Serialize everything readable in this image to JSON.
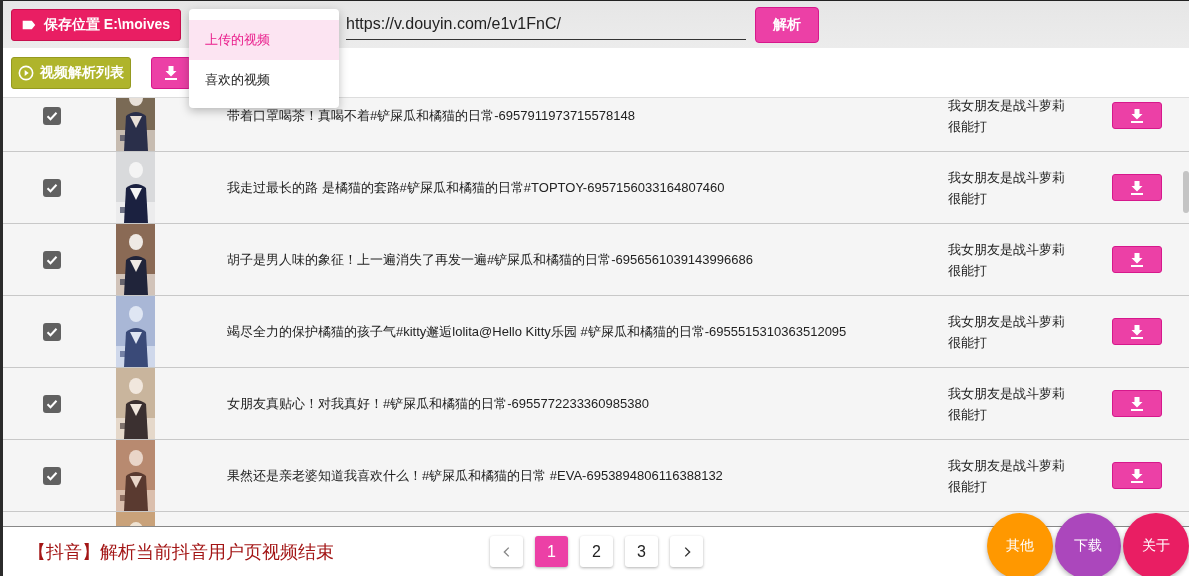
{
  "save_button": {
    "label": "保存位置 E:\\moives"
  },
  "menu": {
    "items": [
      {
        "label": "上传的视频",
        "selected": true
      },
      {
        "label": "喜欢的视频",
        "selected": false
      }
    ]
  },
  "url_field": {
    "value": "https://v.douyin.com/e1v1FnC/"
  },
  "parse_button": {
    "label": "解析"
  },
  "list_button": {
    "label": "视频解析列表"
  },
  "rows": [
    {
      "kind": "full",
      "checked": true,
      "title": "带着口罩喝茶！真喝不着#铲屎瓜和橘猫的日常-6957911973715578148",
      "author": "我女朋友是战斗萝莉很能打"
    },
    {
      "kind": "full",
      "checked": true,
      "title": "我走过最长的路 是橘猫的套路#铲屎瓜和橘猫的日常#TOPTOY-6957156033164807460",
      "author": "我女朋友是战斗萝莉很能打"
    },
    {
      "kind": "full",
      "checked": true,
      "title": "胡子是男人味的象征！上一遍消失了再发一遍#铲屎瓜和橘猫的日常-6956561039143996686",
      "author": "我女朋友是战斗萝莉很能打"
    },
    {
      "kind": "full",
      "checked": true,
      "title": "竭尽全力的保护橘猫的孩子气#kitty邂逅lolita@Hello Kitty乐园 #铲屎瓜和橘猫的日常-6955515310363512095",
      "author": "我女朋友是战斗萝莉很能打"
    },
    {
      "kind": "full",
      "checked": true,
      "title": "女朋友真贴心！对我真好！#铲屎瓜和橘猫的日常-6955772233360985380",
      "author": "我女朋友是战斗萝莉很能打"
    },
    {
      "kind": "full",
      "checked": true,
      "title": "果然还是亲老婆知道我喜欢什么！#铲屎瓜和橘猫的日常 #EVA-6953894806116388132",
      "author": "我女朋友是战斗萝莉很能打"
    },
    {
      "kind": "partial"
    }
  ],
  "status": "【抖音】解析当前抖音用户页视频结束",
  "pagination": {
    "pages": [
      {
        "label": "1",
        "selected": true
      },
      {
        "label": "2",
        "selected": false
      },
      {
        "label": "3",
        "selected": false
      }
    ]
  },
  "fabs": [
    {
      "label": "其他",
      "color": "#ff9800"
    },
    {
      "label": "下载",
      "color": "#ab47bc"
    },
    {
      "label": "关于",
      "color": "#e91e63"
    }
  ]
}
